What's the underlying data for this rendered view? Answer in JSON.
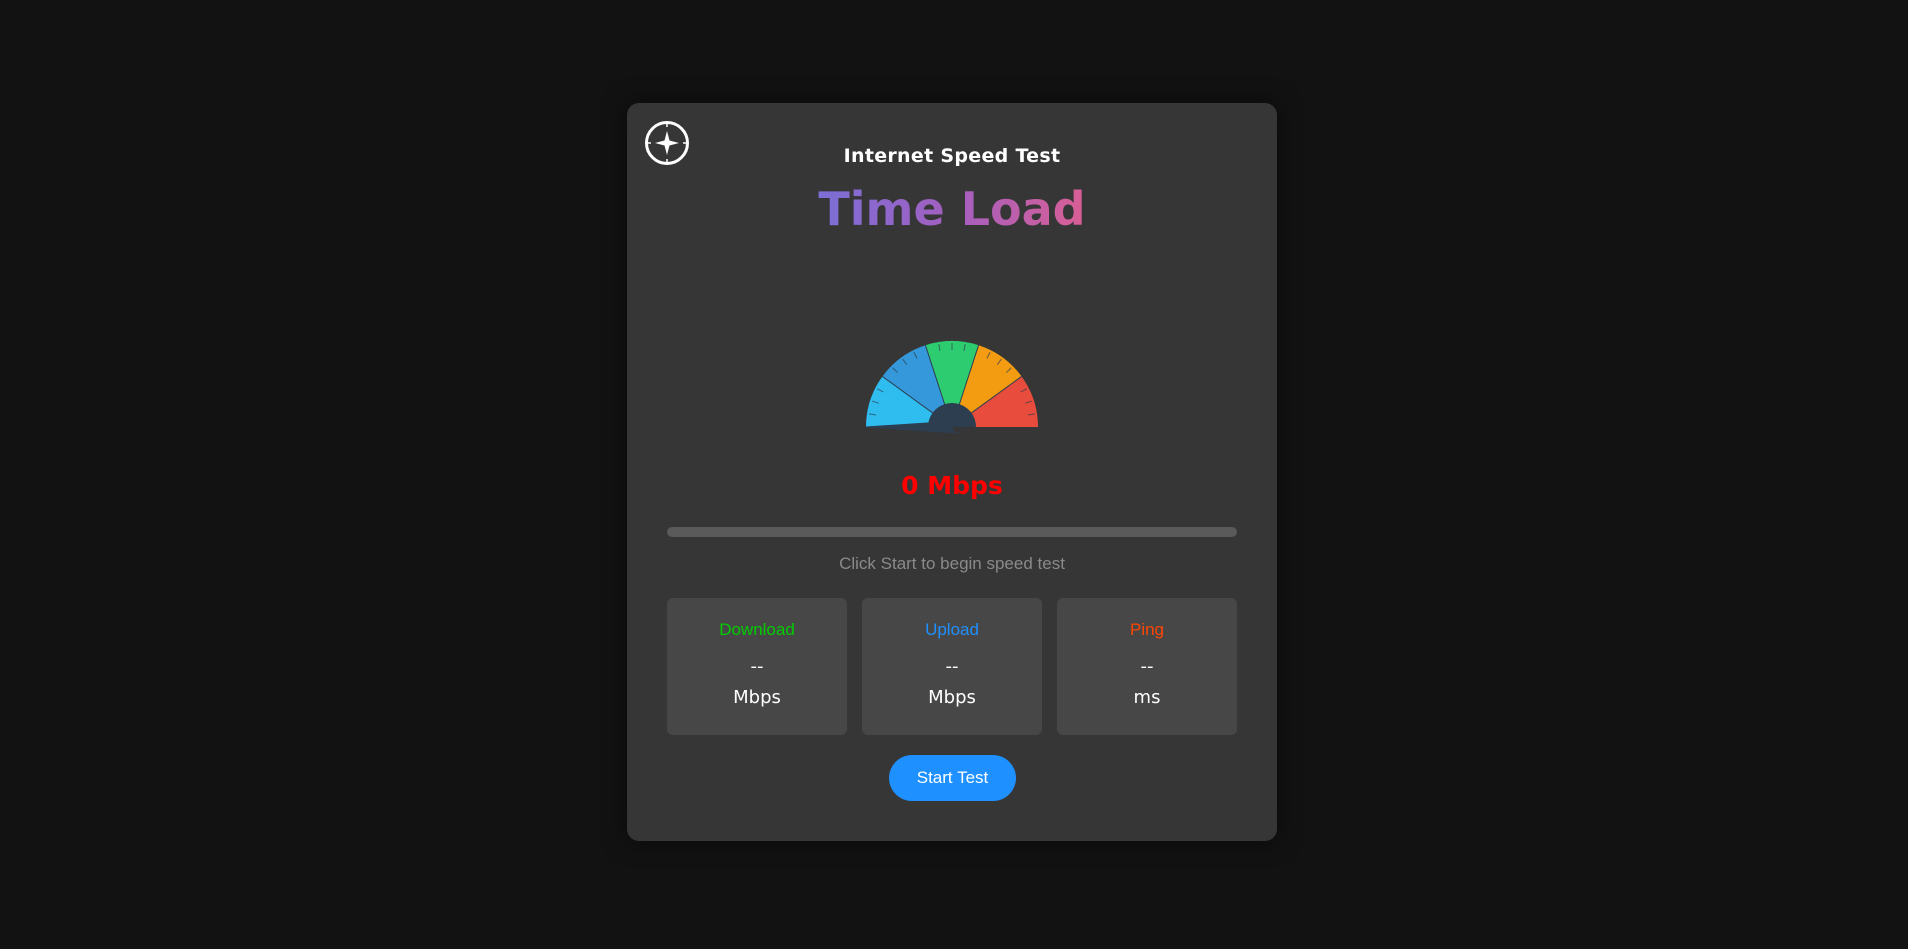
{
  "header": {
    "subtitle": "Internet Speed Test",
    "brand": "Time Load",
    "logo_icon": "compass-icon"
  },
  "gauge": {
    "value": 0,
    "min": 0,
    "max": 100,
    "segments": [
      {
        "color": "#2fbdf0"
      },
      {
        "color": "#3498db"
      },
      {
        "color": "#2ecc71"
      },
      {
        "color": "#f39c12"
      },
      {
        "color": "#e74c3c"
      }
    ],
    "needle_color": "#2c3e50"
  },
  "speed_display": {
    "text": "0 Mbps",
    "color": "#ff0000"
  },
  "progress": {
    "percent": 0
  },
  "status_text": "Click Start to begin speed test",
  "stats": {
    "download": {
      "label": "Download",
      "value": "--",
      "unit": "Mbps",
      "color": "#00cc00"
    },
    "upload": {
      "label": "Upload",
      "value": "--",
      "unit": "Mbps",
      "color": "#1e90ff"
    },
    "ping": {
      "label": "Ping",
      "value": "--",
      "unit": "ms",
      "color": "#ff4500"
    }
  },
  "start_button": {
    "label": "Start Test",
    "color": "#1e90ff"
  }
}
